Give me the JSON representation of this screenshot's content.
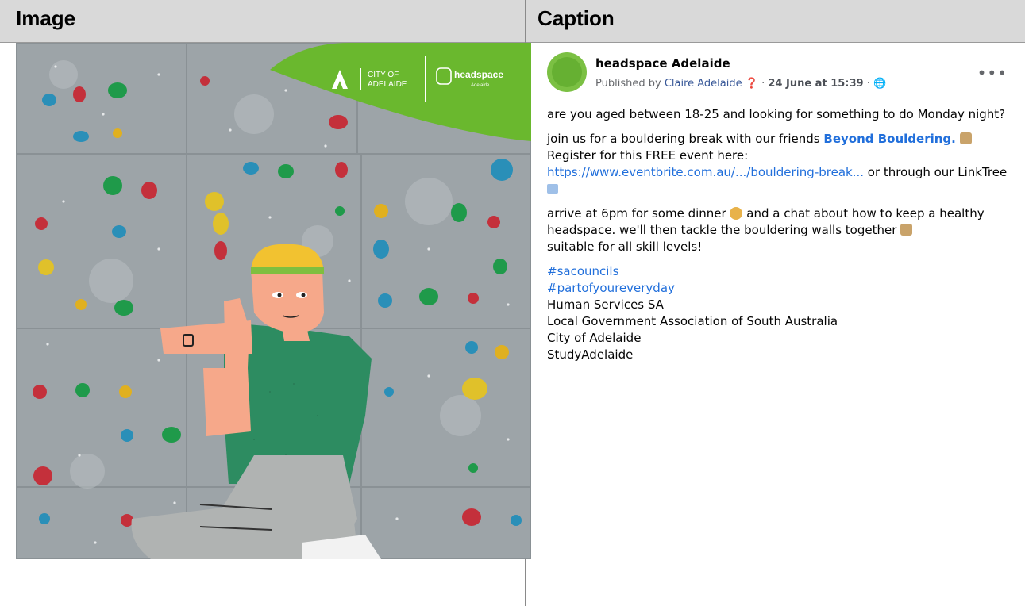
{
  "table": {
    "col1_header": "Image",
    "col2_header": "Caption"
  },
  "image": {
    "logo_city": "CITY OF",
    "logo_city2": "ADELAIDE",
    "logo_headspace": "headspace",
    "logo_sub": "Adelaide",
    "accent_color": "#6ab82e"
  },
  "post": {
    "page_name": "headspace Adelaide",
    "published_prefix": "Published by",
    "author": "Claire Adelaide",
    "date": "24 June at 15:39",
    "more_label": "•••",
    "para1": "are you aged between 18-25 and looking for something to do Monday night?",
    "para2_a": "join us for a bouldering break with our friends",
    "para2_link": "Beyond Bouldering.",
    "para2_b": "Register for this FREE event here:",
    "para2_url": "https://www.eventbrite.com.au/.../bouldering-break...",
    "para2_c": "or through our LinkTree",
    "para3_a": "arrive at 6pm for some dinner",
    "para3_b": "and a chat about how to keep a healthy headspace. we'll then tackle the bouldering walls together",
    "para3_c": "suitable for all skill levels!",
    "hashtag1": "#sacouncils",
    "hashtag2": "#partofyoureveryday",
    "tag1": "Human Services SA",
    "tag2": "Local Government Association of South Australia",
    "tag3": "City of Adelaide",
    "tag4": "StudyAdelaide"
  }
}
